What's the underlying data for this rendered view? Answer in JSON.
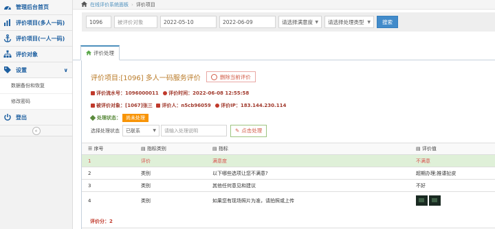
{
  "sidebar": {
    "items": [
      {
        "label": "管理后台首页",
        "icon": "dashboard-icon"
      },
      {
        "label": "评价项目(多人一码)",
        "icon": "bar-chart-icon"
      },
      {
        "label": "评价项目(一人一码)",
        "icon": "anchor-icon"
      },
      {
        "label": "评价对象",
        "icon": "sitemap-icon"
      },
      {
        "label": "设置",
        "icon": "tag-icon"
      }
    ],
    "sub_items": [
      {
        "label": "数据备份和恢复"
      },
      {
        "label": "修改密码"
      }
    ],
    "logout": {
      "label": "登出",
      "icon": "power-icon"
    },
    "collapse_icon": "double-chevron-left-icon"
  },
  "breadcrumb": {
    "home": "在线评价系统面板",
    "current": "评价项目"
  },
  "search": {
    "id_value": "1096",
    "target_placeholder": "被评价对象",
    "date_from": "2022-05-10",
    "date_to": "2022-06-09",
    "satisfaction_select": "请选择满意度",
    "process_type_select": "请选择处理类型",
    "search_button": "搜索"
  },
  "tab": {
    "label": "评价处理"
  },
  "detail": {
    "title": "评价项目:[1096] 多人一码服务评价",
    "delete_button": "删除当前评价",
    "line1": {
      "serial_label": "评价流水号：",
      "serial_value": "1096000011",
      "time_label": "评价时间：",
      "time_value": "2022-06-08 12:55:58"
    },
    "line2": {
      "target_label": "被评价对象：",
      "target_value": "[1067]张三",
      "rater_label": "评价人：",
      "rater_value": "n5cb96059",
      "ip_label": "评价IP：",
      "ip_value": "183.144.230.114"
    },
    "status_label": "处理状态：",
    "status_value": "尚未处理",
    "process": {
      "label": "选择处理状态",
      "select_value": "已联系",
      "input_placeholder": "请输入处理说明",
      "submit_button": "点击处理"
    }
  },
  "table": {
    "headers": [
      "序号",
      "指标类别",
      "指标",
      "评价值"
    ],
    "rows": [
      {
        "no": "1",
        "category": "评价",
        "indicator": "满意度",
        "value": "不满意"
      },
      {
        "no": "2",
        "category": "类别",
        "indicator": "以下哪些选项让您不满意?",
        "value": "超期办理;推诿扯皮"
      },
      {
        "no": "3",
        "category": "类别",
        "indicator": "其他任何意见和建议",
        "value": "不好"
      },
      {
        "no": "4",
        "category": "类别",
        "indicator": "如果您有现场照片为准，请拍照或上传",
        "value": ""
      }
    ],
    "score_label": "评价分：2"
  },
  "colors": {
    "accent": "#428bca",
    "title": "#b97a27",
    "danger": "#d15b47",
    "highlight_row": "#dff0d8",
    "status_badge": "#f89406"
  }
}
